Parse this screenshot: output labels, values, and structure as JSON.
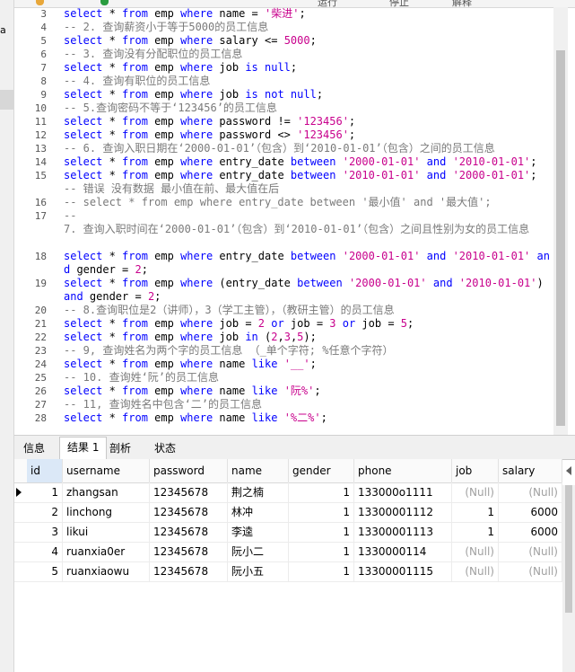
{
  "left_strip": {
    "cut_text": "a"
  },
  "toolbar": {
    "run_label": "运行",
    "stop_label": "停止",
    "explain_label": "解释"
  },
  "editor": {
    "lines": [
      {
        "n": "3",
        "tokens": [
          [
            "kw",
            "select"
          ],
          [
            "ident",
            " * "
          ],
          [
            "kw",
            "from"
          ],
          [
            "ident",
            " emp "
          ],
          [
            "kw",
            "where"
          ],
          [
            "ident",
            " name = "
          ],
          [
            "str",
            "'柴进'"
          ],
          [
            "ident",
            ";"
          ]
        ]
      },
      {
        "n": "4",
        "tokens": [
          [
            "cm",
            "-- 2. 查询薪资小于等于5000的员工信息"
          ]
        ]
      },
      {
        "n": "5",
        "tokens": [
          [
            "kw",
            "select"
          ],
          [
            "ident",
            " * "
          ],
          [
            "kw",
            "from"
          ],
          [
            "ident",
            " emp "
          ],
          [
            "kw",
            "where"
          ],
          [
            "ident",
            " salary <= "
          ],
          [
            "num-lit",
            "5000"
          ],
          [
            "ident",
            ";"
          ]
        ]
      },
      {
        "n": "6",
        "tokens": [
          [
            "cm",
            "-- 3. 查询没有分配职位的员工信息"
          ]
        ]
      },
      {
        "n": "7",
        "tokens": [
          [
            "kw",
            "select"
          ],
          [
            "ident",
            " * "
          ],
          [
            "kw",
            "from"
          ],
          [
            "ident",
            " emp "
          ],
          [
            "kw",
            "where"
          ],
          [
            "ident",
            " job "
          ],
          [
            "kw",
            "is null"
          ],
          [
            "ident",
            ";"
          ]
        ]
      },
      {
        "n": "8",
        "tokens": [
          [
            "cm",
            "-- 4. 查询有职位的员工信息"
          ]
        ]
      },
      {
        "n": "9",
        "tokens": [
          [
            "kw",
            "select"
          ],
          [
            "ident",
            " * "
          ],
          [
            "kw",
            "from"
          ],
          [
            "ident",
            " emp "
          ],
          [
            "kw",
            "where"
          ],
          [
            "ident",
            " job "
          ],
          [
            "kw",
            "is not null"
          ],
          [
            "ident",
            ";"
          ]
        ]
      },
      {
        "n": "10",
        "tokens": [
          [
            "cm",
            "-- 5.查询密码不等于‘123456’的员工信息"
          ]
        ]
      },
      {
        "n": "11",
        "tokens": [
          [
            "kw",
            "select"
          ],
          [
            "ident",
            " * "
          ],
          [
            "kw",
            "from"
          ],
          [
            "ident",
            " emp "
          ],
          [
            "kw",
            "where"
          ],
          [
            "ident",
            " password != "
          ],
          [
            "str",
            "'123456'"
          ],
          [
            "ident",
            ";"
          ]
        ]
      },
      {
        "n": "12",
        "tokens": [
          [
            "kw",
            "select"
          ],
          [
            "ident",
            " * "
          ],
          [
            "kw",
            "from"
          ],
          [
            "ident",
            " emp "
          ],
          [
            "kw",
            "where"
          ],
          [
            "ident",
            " password <> "
          ],
          [
            "str",
            "'123456'"
          ],
          [
            "ident",
            ";"
          ]
        ]
      },
      {
        "n": "13",
        "tokens": [
          [
            "cm",
            "-- 6. 查询入职日期在‘2000-01-01’（包含）到‘2010-01-01’（包含）之间的员工信息"
          ]
        ]
      },
      {
        "n": "14",
        "tokens": [
          [
            "kw",
            "select"
          ],
          [
            "ident",
            " * "
          ],
          [
            "kw",
            "from"
          ],
          [
            "ident",
            " emp "
          ],
          [
            "kw",
            "where"
          ],
          [
            "ident",
            " entry_date "
          ],
          [
            "kw",
            "between"
          ],
          [
            "ident",
            " "
          ],
          [
            "str",
            "'2000-01-01'"
          ],
          [
            "ident",
            " "
          ],
          [
            "kw",
            "and"
          ],
          [
            "ident",
            " "
          ],
          [
            "str",
            "'2010-01-01'"
          ],
          [
            "ident",
            ";"
          ]
        ]
      },
      {
        "n": "15",
        "tokens": [
          [
            "kw",
            "select"
          ],
          [
            "ident",
            " * "
          ],
          [
            "kw",
            "from"
          ],
          [
            "ident",
            " emp "
          ],
          [
            "kw",
            "where"
          ],
          [
            "ident",
            " entry_date "
          ],
          [
            "kw",
            "between"
          ],
          [
            "ident",
            " "
          ],
          [
            "str",
            "'2010-01-01'"
          ],
          [
            "ident",
            " "
          ],
          [
            "kw",
            "and"
          ],
          [
            "ident",
            " "
          ],
          [
            "str",
            "'2000-01-01'"
          ],
          [
            "ident",
            ";"
          ]
        ]
      },
      {
        "n": "",
        "tokens": [
          [
            "cm",
            "-- 错误 没有数据 最小值在前、最大值在后"
          ]
        ]
      },
      {
        "n": "16",
        "tokens": [
          [
            "cm",
            "-- select * from emp where entry_date between '最小值' and '最大值';"
          ]
        ]
      },
      {
        "n": "17",
        "tokens": [
          [
            "cm",
            "--"
          ]
        ]
      },
      {
        "n": "",
        "wrap": true,
        "tokens": [
          [
            "cm",
            "7. 查询入职时间在‘2000-01-01’（包含）到‘2010-01-01’（包含）之间且性别为女的员工信息"
          ]
        ]
      },
      {
        "n": "18",
        "wrap": true,
        "tokens": [
          [
            "kw",
            "select"
          ],
          [
            "ident",
            " * "
          ],
          [
            "kw",
            "from"
          ],
          [
            "ident",
            " emp "
          ],
          [
            "kw",
            "where"
          ],
          [
            "ident",
            " entry_date "
          ],
          [
            "kw",
            "between"
          ],
          [
            "ident",
            " "
          ],
          [
            "str",
            "'2000-01-01'"
          ],
          [
            "ident",
            " "
          ],
          [
            "kw",
            "and"
          ],
          [
            "ident",
            " "
          ],
          [
            "str",
            "'2010-01-01'"
          ],
          [
            "ident",
            " "
          ],
          [
            "kw",
            "and"
          ],
          [
            "ident",
            " gender = "
          ],
          [
            "num-lit",
            "2"
          ],
          [
            "ident",
            ";"
          ]
        ]
      },
      {
        "n": "19",
        "wrap": true,
        "tokens": [
          [
            "kw",
            "select"
          ],
          [
            "ident",
            " * "
          ],
          [
            "kw",
            "from"
          ],
          [
            "ident",
            " emp "
          ],
          [
            "kw",
            "where"
          ],
          [
            "ident",
            " (entry_date "
          ],
          [
            "kw",
            "between"
          ],
          [
            "ident",
            " "
          ],
          [
            "str",
            "'2000-01-01'"
          ],
          [
            "ident",
            " "
          ],
          [
            "kw",
            "and"
          ],
          [
            "ident",
            " "
          ],
          [
            "str",
            "'2010-01-01'"
          ],
          [
            "ident",
            ") "
          ],
          [
            "kw",
            "and"
          ],
          [
            "ident",
            " gender = "
          ],
          [
            "num-lit",
            "2"
          ],
          [
            "ident",
            ";"
          ]
        ]
      },
      {
        "n": "20",
        "tokens": [
          [
            "cm",
            "-- 8.查询职位是2（讲师），3（学工主管），（教研主管）的员工信息"
          ]
        ]
      },
      {
        "n": "21",
        "tokens": [
          [
            "kw",
            "select"
          ],
          [
            "ident",
            " * "
          ],
          [
            "kw",
            "from"
          ],
          [
            "ident",
            " emp "
          ],
          [
            "kw",
            "where"
          ],
          [
            "ident",
            " job = "
          ],
          [
            "num-lit",
            "2"
          ],
          [
            "ident",
            " "
          ],
          [
            "kw",
            "or"
          ],
          [
            "ident",
            " job = "
          ],
          [
            "num-lit",
            "3"
          ],
          [
            "ident",
            " "
          ],
          [
            "kw",
            "or"
          ],
          [
            "ident",
            " job = "
          ],
          [
            "num-lit",
            "5"
          ],
          [
            "ident",
            ";"
          ]
        ]
      },
      {
        "n": "22",
        "tokens": [
          [
            "kw",
            "select"
          ],
          [
            "ident",
            " * "
          ],
          [
            "kw",
            "from"
          ],
          [
            "ident",
            " emp "
          ],
          [
            "kw",
            "where"
          ],
          [
            "ident",
            " job "
          ],
          [
            "kw",
            "in"
          ],
          [
            "ident",
            " ("
          ],
          [
            "num-lit",
            "2"
          ],
          [
            "ident",
            ","
          ],
          [
            "num-lit",
            "3"
          ],
          [
            "ident",
            ","
          ],
          [
            "num-lit",
            "5"
          ],
          [
            "ident",
            ");"
          ]
        ]
      },
      {
        "n": "23",
        "tokens": [
          [
            "cm",
            "-- 9, 查询姓名为两个字的员工信息 （_单个字符; %任意个字符）"
          ]
        ]
      },
      {
        "n": "24",
        "tokens": [
          [
            "kw",
            "select"
          ],
          [
            "ident",
            " * "
          ],
          [
            "kw",
            "from"
          ],
          [
            "ident",
            " emp "
          ],
          [
            "kw",
            "where"
          ],
          [
            "ident",
            " name "
          ],
          [
            "kw",
            "like"
          ],
          [
            "ident",
            " "
          ],
          [
            "str",
            "'__'"
          ],
          [
            "ident",
            ";"
          ]
        ]
      },
      {
        "n": "25",
        "tokens": [
          [
            "cm",
            "-- 10. 查询姓‘阮’的员工信息"
          ]
        ]
      },
      {
        "n": "26",
        "tokens": [
          [
            "kw",
            "select"
          ],
          [
            "ident",
            " * "
          ],
          [
            "kw",
            "from"
          ],
          [
            "ident",
            " emp "
          ],
          [
            "kw",
            "where"
          ],
          [
            "ident",
            " name "
          ],
          [
            "kw",
            "like"
          ],
          [
            "ident",
            " "
          ],
          [
            "str",
            "'阮%'"
          ],
          [
            "ident",
            ";"
          ]
        ]
      },
      {
        "n": "27",
        "tokens": [
          [
            "cm",
            "-- 11, 查询姓名中包含‘二’的员工信息"
          ]
        ]
      },
      {
        "n": "28",
        "tokens": [
          [
            "kw",
            "select"
          ],
          [
            "ident",
            " * "
          ],
          [
            "kw",
            "from"
          ],
          [
            "ident",
            " emp "
          ],
          [
            "kw",
            "where"
          ],
          [
            "ident",
            " name "
          ],
          [
            "kw",
            "like"
          ],
          [
            "ident",
            " "
          ],
          [
            "str",
            "'%二%'"
          ],
          [
            "ident",
            ";"
          ]
        ]
      }
    ]
  },
  "tabs": [
    {
      "label": "信息",
      "active": false
    },
    {
      "label": "结果 1",
      "active": true
    },
    {
      "label": "剖析",
      "active": false
    },
    {
      "label": "状态",
      "active": false
    }
  ],
  "grid": {
    "columns": [
      "id",
      "username",
      "password",
      "name",
      "gender",
      "phone",
      "job",
      "salary"
    ],
    "rows": [
      [
        "1",
        "zhangsan",
        "12345678",
        "荆之楠",
        "1",
        "133000o1111",
        "(Null)",
        "(Null)"
      ],
      [
        "2",
        "linchong",
        "12345678",
        "林冲",
        "1",
        "13300001112",
        "1",
        "6000"
      ],
      [
        "3",
        "likui",
        "12345678",
        "李逵",
        "1",
        "13300001113",
        "1",
        "6000"
      ],
      [
        "4",
        "ruanxia0er",
        "12345678",
        "阮小二",
        "1",
        "1330000114",
        "(Null)",
        "(Null)"
      ],
      [
        "5",
        "ruanxiaowu",
        "12345678",
        "阮小五",
        "1",
        "13300001115",
        "(Null)",
        "(Null)"
      ]
    ],
    "null_text": "(Null)"
  },
  "colors": {
    "keyword": "#0000ff",
    "string": "#c8008c",
    "comment": "#7a7a7a"
  }
}
